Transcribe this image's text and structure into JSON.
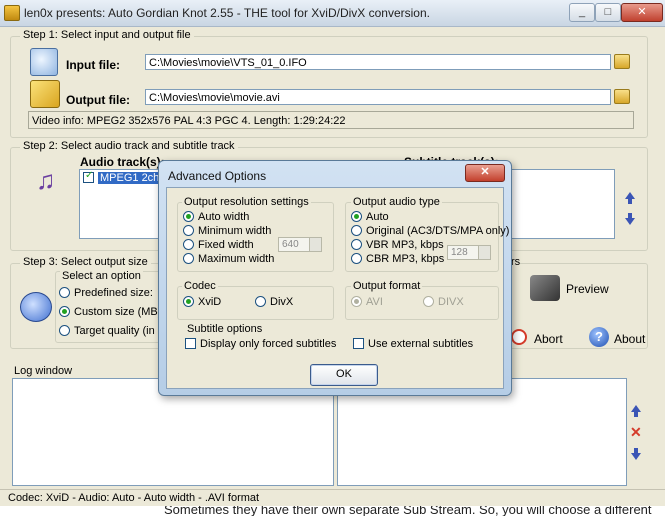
{
  "window": {
    "title": "len0x presents: Auto Gordian Knot 2.55 - THE tool for XviD/DivX conversion.",
    "min": "_",
    "max": "□",
    "close": "✕"
  },
  "step1": {
    "label": "Step 1: Select input and output file",
    "input_label": "Input file:",
    "input_value": "C:\\Movies\\movie\\VTS_01_0.IFO",
    "output_label": "Output file:",
    "output_value": "C:\\Movies\\movie\\movie.avi",
    "video_info": "Video info: MPEG2 352x576 PAL 4:3   PGC 4. Length: 1:29:24:22"
  },
  "step2": {
    "label": "Step 2: Select audio track and subtitle track",
    "audio_label": "Audio track(s):",
    "audio_item": "MPEG1 2ch",
    "subtitle_label": "Subtitle track(s):"
  },
  "step3": {
    "label": "Step 3: Select output size",
    "select_option": "Select an option",
    "predefined": "Predefined size:",
    "custom": "Custom size (MB):",
    "target": "Target quality (in pe"
  },
  "actions": {
    "preview": "Preview",
    "abort": "Abort",
    "about": "About",
    "partial_label": "rs"
  },
  "log": {
    "label": "Log window"
  },
  "status": "Codec: XviD -  Audio: Auto -  Auto width - .AVI format",
  "below_text": "Sometimes they have their own separate Sub Stream. So, you will choose a different",
  "dialog": {
    "title": "Advanced Options",
    "close": "✕",
    "res_group": "Output resolution settings",
    "res_options": [
      "Auto width",
      "Minimum width",
      "Fixed width",
      "Maximum width"
    ],
    "fixed_width_value": "640",
    "audio_group": "Output audio type",
    "audio_options": [
      "Auto",
      "Original (AC3/DTS/MPA only)",
      "VBR MP3, kbps",
      "CBR MP3, kbps"
    ],
    "mp3_value": "128",
    "codec_group": "Codec",
    "codec_options": [
      "XviD",
      "DivX"
    ],
    "format_group": "Output format",
    "format_options": [
      "AVI",
      "DIVX"
    ],
    "sub_group": "Subtitle options",
    "sub_forced": "Display only forced subtitles",
    "sub_external": "Use external subtitles",
    "ok": "OK"
  }
}
